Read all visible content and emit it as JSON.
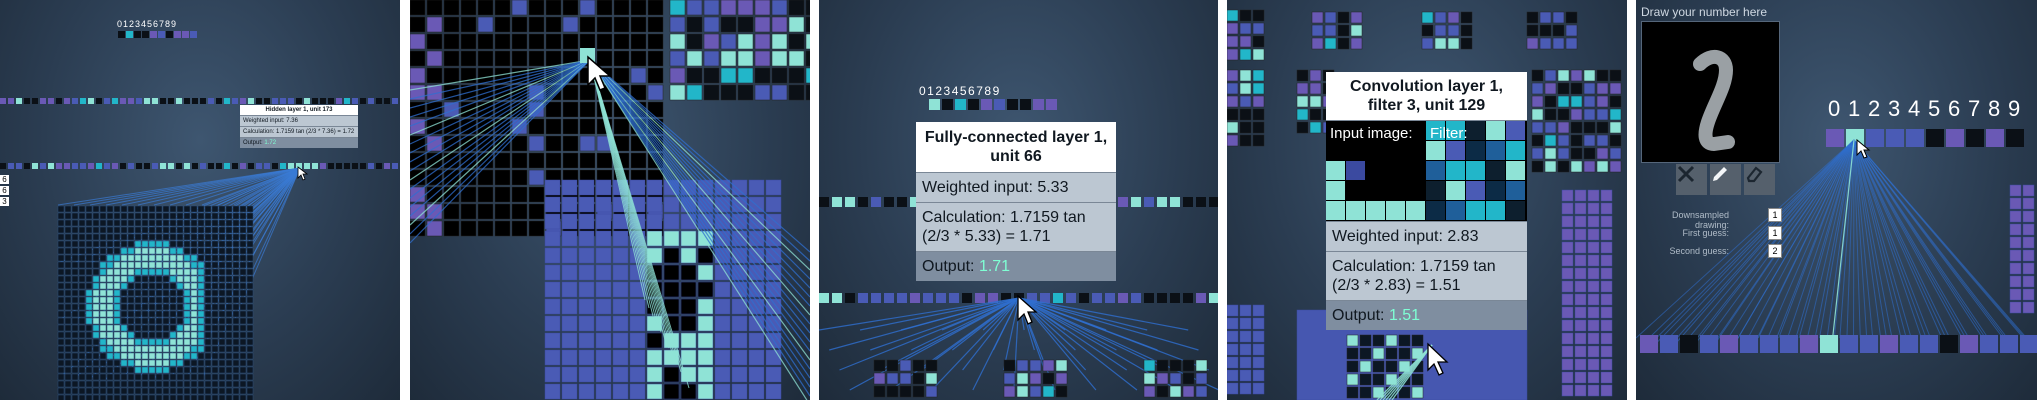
{
  "digits_label": "0123456789",
  "panel1": {
    "tooltip": {
      "title": "Hidden layer 1, unit 173",
      "weighted": "Weighted input: 7.36",
      "calc": "Calculation: 1.7159 tan (2/3 * 7.36) = 1.72",
      "output_label": "Output:",
      "output_value": "1.72"
    },
    "left_numbers": [
      "6",
      "6",
      "3"
    ]
  },
  "panel3": {
    "tooltip": {
      "title": "Fully-connected layer 1, unit 66",
      "weighted": "Weighted input: 5.33",
      "calc": "Calculation: 1.7159 tan (2/3 * 5.33) = 1.71",
      "output_label": "Output:",
      "output_value": "1.71"
    }
  },
  "panel4": {
    "tooltip": {
      "title": "Convolution layer 1, filter 3, unit 129",
      "input_label": "Input image:",
      "filter_label": "Filter:",
      "weighted": "Weighted input: 2.83",
      "calc": "Calculation: 1.7159 tan (2/3 * 2.83) = 1.51",
      "output_label": "Output:",
      "output_value": "1.51"
    }
  },
  "panel5": {
    "draw_title": "Draw your number here",
    "digits": [
      "0",
      "1",
      "2",
      "3",
      "4",
      "5",
      "6",
      "7",
      "8",
      "9"
    ],
    "tools": {
      "clear": "clear-icon",
      "pen": "pencil-icon",
      "eraser": "eraser-icon"
    },
    "guesses": [
      {
        "label": "Downsampled drawing:",
        "value": "1"
      },
      {
        "label": "First guess:",
        "value": "1"
      },
      {
        "label": "Second guess:",
        "value": "2"
      }
    ]
  },
  "colors": {
    "background": "#2b3d52",
    "cell_dark": "#0b1016",
    "cell_blue": "#4a5bb5",
    "cell_purple": "#6a59b5",
    "cell_cyan": "#8fe3d6",
    "cell_teal": "#22b6c9",
    "output_value": "#7fffd4"
  }
}
